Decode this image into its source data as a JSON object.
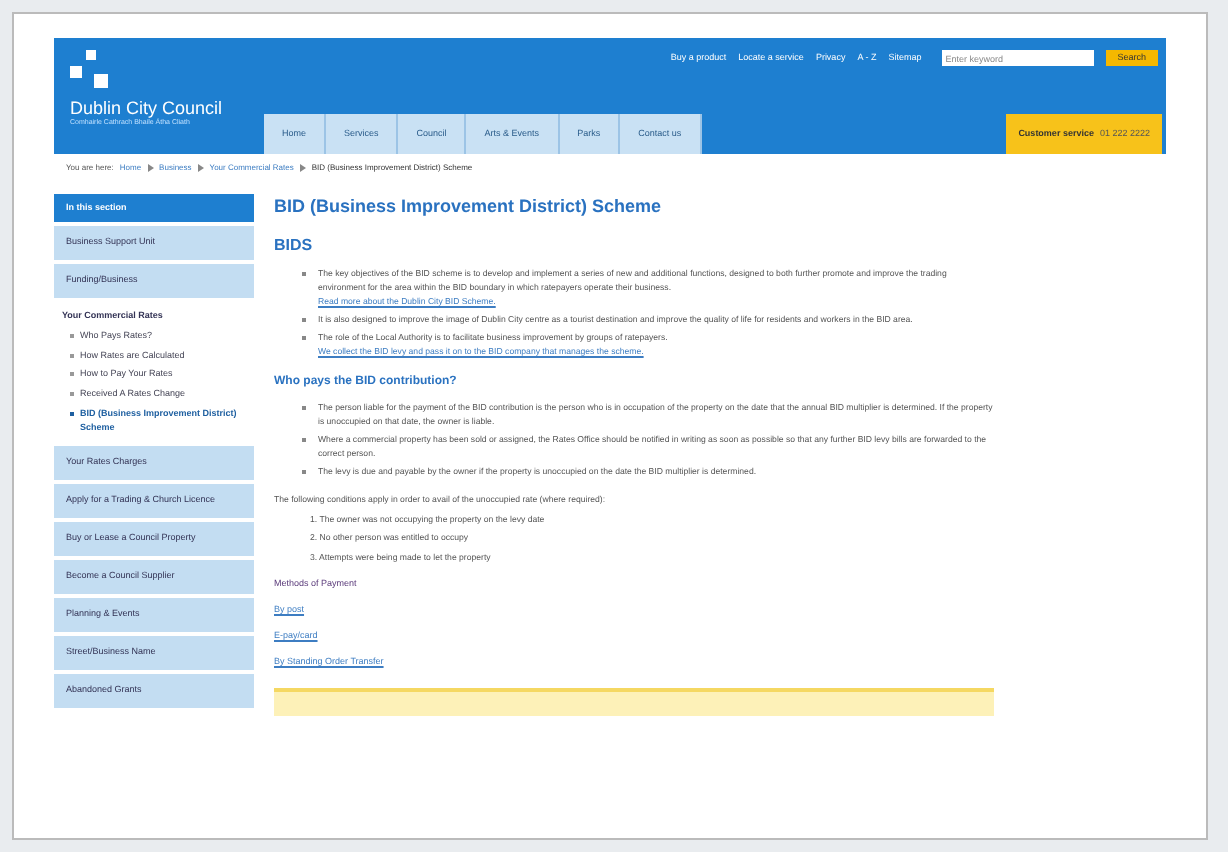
{
  "header": {
    "logo_text": "Dublin City Council",
    "logo_tagline": "Comhairle Cathrach Bhaile Átha Cliath",
    "top_links": [
      "Buy a product",
      "Locate a service",
      "Privacy",
      "A - Z",
      "Sitemap"
    ],
    "search": {
      "placeholder": "Enter keyword",
      "button": "Search"
    },
    "nav": [
      {
        "label": "Home",
        "selected": false
      },
      {
        "label": "Services",
        "selected": false
      },
      {
        "label": "Council",
        "selected": false
      },
      {
        "label": "Arts & Events",
        "selected": false
      },
      {
        "label": "Parks",
        "selected": false
      },
      {
        "label": "Contact us",
        "selected": false
      }
    ],
    "customer_service": {
      "label": "Customer service",
      "phone": "01 222 2222"
    }
  },
  "breadcrumb": {
    "prefix": "You are here:",
    "items": [
      "Home",
      "Business",
      "Your Commercial Rates",
      "BID (Business Improvement District) Scheme"
    ]
  },
  "sidebar": {
    "title": "In this section",
    "items": [
      {
        "label": "Business Support Unit",
        "selected": false
      },
      {
        "label": "Funding/Business",
        "selected": false
      },
      {
        "label": "Your Commercial Rates",
        "selected": false,
        "children": [
          {
            "label": "Who Pays Rates?",
            "selected": false
          },
          {
            "label": "How Rates are Calculated",
            "selected": false
          },
          {
            "label": "How to Pay Your Rates",
            "selected": false
          },
          {
            "label": "Received A Rates Change",
            "selected": false
          },
          {
            "label": "BID (Business Improvement District) Scheme",
            "selected": true
          }
        ]
      },
      {
        "label": "Your Rates Charges",
        "selected": false
      },
      {
        "label": "Apply for a Trading & Church Licence",
        "selected": false
      },
      {
        "label": "Buy or Lease a Council Property",
        "selected": false
      },
      {
        "label": "Become a Council Supplier",
        "selected": false
      },
      {
        "label": "Planning & Events",
        "selected": false
      },
      {
        "label": "Street/Business Name",
        "selected": false
      },
      {
        "label": "Abandoned Grants",
        "selected": false
      }
    ]
  },
  "main": {
    "title": "BID (Business Improvement District) Scheme",
    "sections": [
      {
        "heading": "BIDS",
        "bullets": [
          {
            "text": "The key objectives of the BID scheme is to develop and implement a series of new and additional functions, designed to both further promote and improve the trading environment for the area within the BID boundary in which ratepayers operate their business.",
            "link": "Read more about the Dublin City BID Scheme."
          },
          {
            "text": "It is also designed to improve the image of Dublin City centre as a tourist destination and improve the quality of life for residents and workers in the BID area."
          },
          {
            "text": "The role of the Local Authority is to facilitate business improvement by groups of ratepayers.",
            "link": "We collect the BID levy and pass it on to the BID company that manages the scheme."
          }
        ]
      },
      {
        "heading": "Who pays the BID contribution?",
        "bullets": [
          {
            "text": "The person liable for the payment of the BID contribution is the person who is in occupation of the property on the date that the annual BID multiplier is determined. If the property is unoccupied on that date, the owner is liable."
          },
          {
            "text": "Where a commercial property has been sold or assigned, the Rates Office should be notified in writing as soon as possible so that any further BID levy bills are forwarded to the correct person."
          },
          {
            "text": "The levy is due and payable by the owner if the property is unoccupied on the date the BID multiplier is determined."
          }
        ]
      }
    ],
    "conditions_intro": "The following conditions apply in order to avail of the unoccupied rate (where required):",
    "conditions": [
      "1. The owner was not occupying the property on the levy date",
      "2. No other person was entitled to occupy",
      "3. Attempts were being made to let the property"
    ],
    "payment_heading": "Methods of Payment",
    "payment_links": [
      "By post",
      "E-pay/card",
      "By Standing Order Transfer"
    ]
  }
}
